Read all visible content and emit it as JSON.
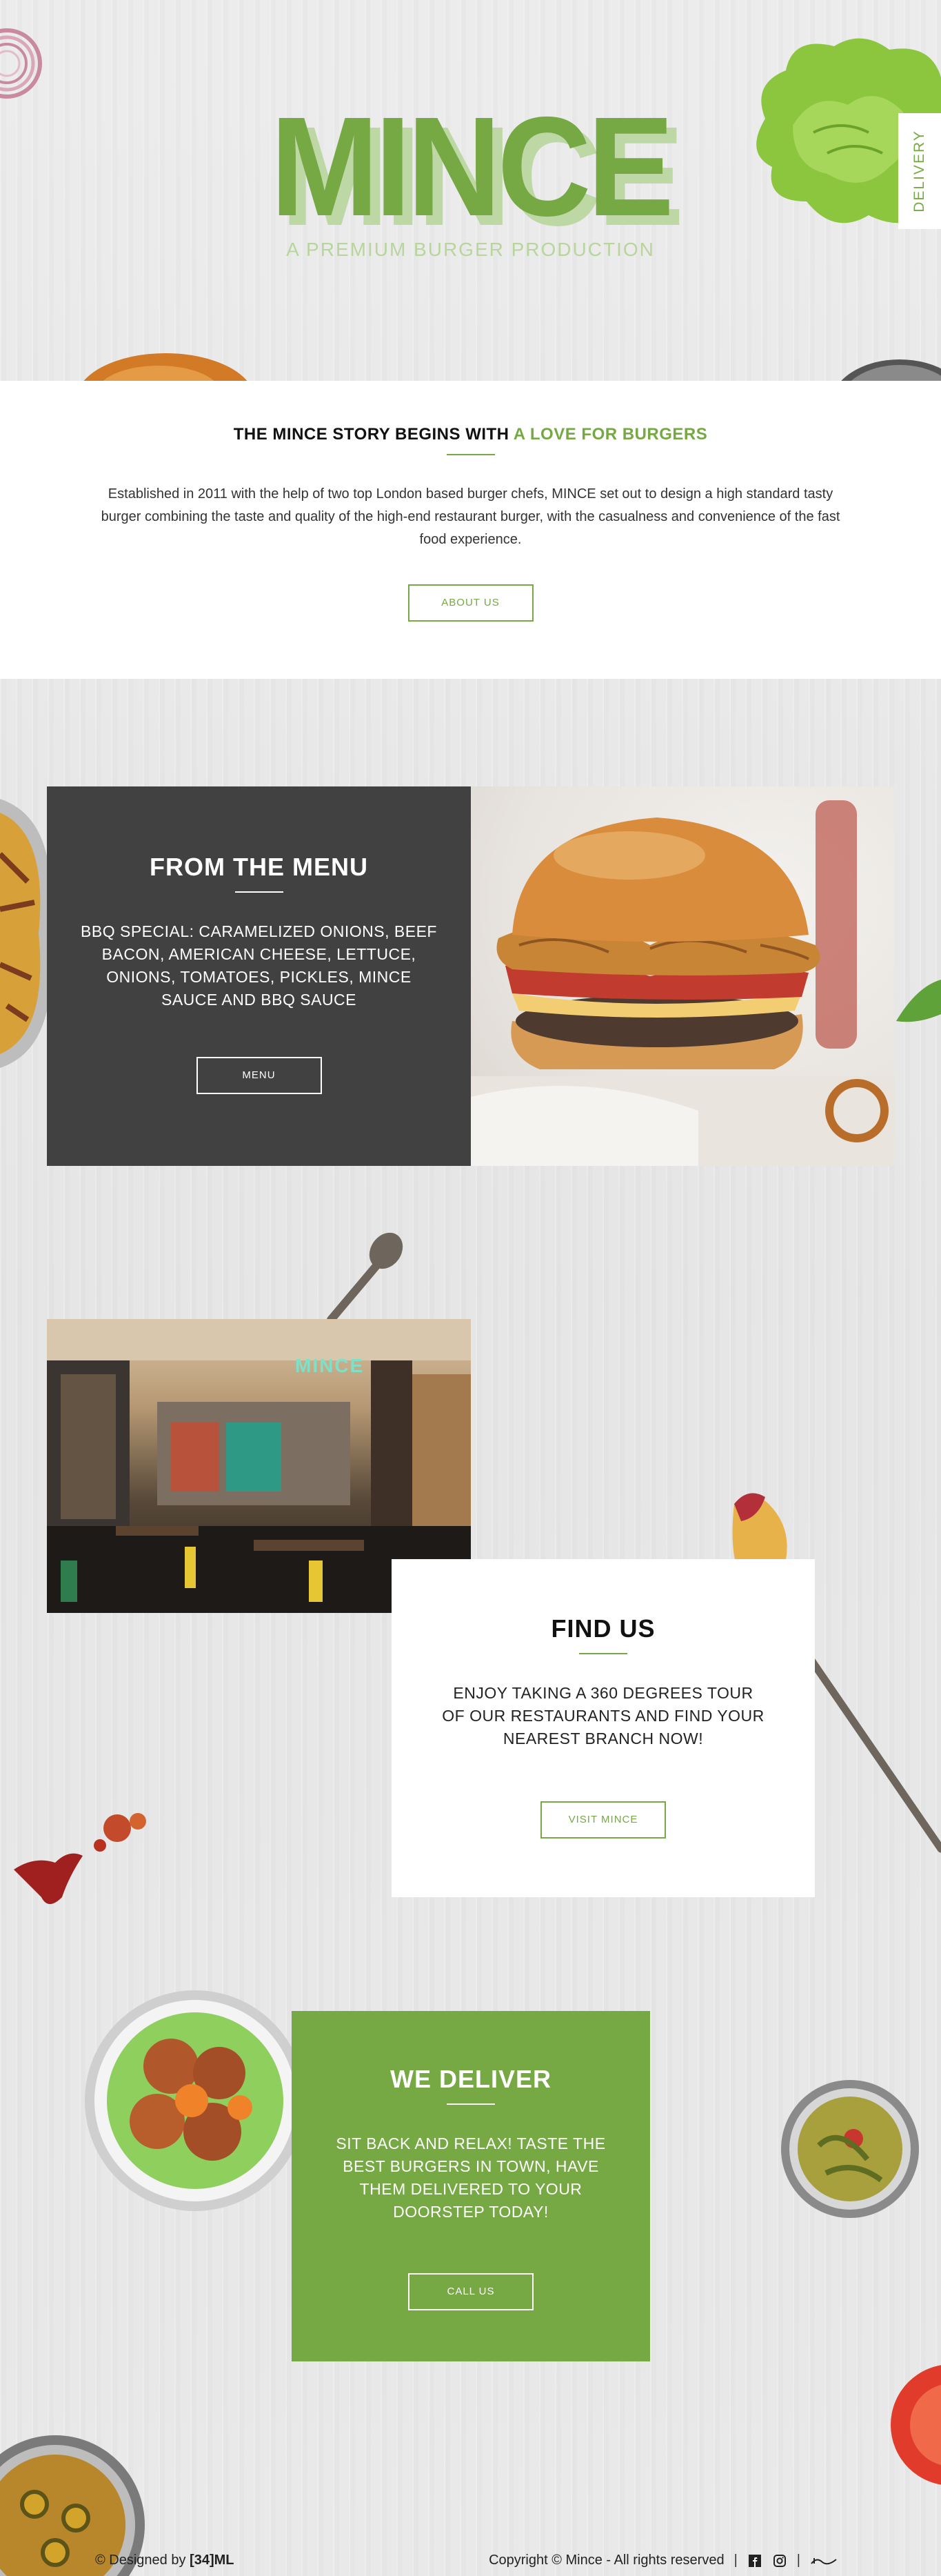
{
  "hero": {
    "logo": "MINCE",
    "tagline": "A PREMIUM BURGER PRODUCTION",
    "delivery_tab": "DELIVERY"
  },
  "story": {
    "title_prefix": "THE MINCE STORY BEGINS WITH ",
    "title_accent": "A LOVE FOR BURGERS",
    "body": "Established in 2011 with the help of two top London based burger chefs, MINCE set out to design a high standard tasty burger combining the taste and quality of the high-end restaurant burger, with the casualness and convenience of the fast food experience.",
    "button": "ABOUT US"
  },
  "menu": {
    "title": "FROM THE MENU",
    "body": "BBQ SPECIAL: CARAMELIZED ONIONS, BEEF BACON, AMERICAN CHEESE, LETTUCE, ONIONS, TOMATOES, PICKLES, MINCE SAUCE AND BBQ SAUCE",
    "button": "MENU"
  },
  "restaurant_photo": {
    "sign": "MINCE"
  },
  "find_us": {
    "title": "FIND US",
    "body": "ENJOY TAKING A 360 DEGREES TOUR OF OUR RESTAURANTS AND FIND YOUR NEAREST BRANCH NOW!",
    "button": "VISIT MINCE"
  },
  "deliver": {
    "title": "WE DELIVER",
    "body": "SIT BACK AND RELAX! TASTE THE BEST BURGERS IN TOWN, HAVE THEM DELIVERED TO YOUR DOORSTEP TODAY!",
    "button": "CALL US"
  },
  "footer": {
    "designed_prefix": "© Designed by ",
    "designer": "[34]ML",
    "copyright": "Copyright © Mince - All rights reserved",
    "separator": "|",
    "icons": [
      "facebook-icon",
      "instagram-icon",
      "wave-logo-icon"
    ]
  },
  "colors": {
    "brand_green": "#76a844",
    "light_green": "#bed8a5",
    "dark_panel": "#414141"
  }
}
